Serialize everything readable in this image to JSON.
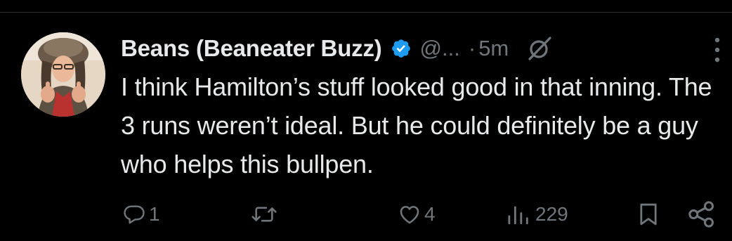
{
  "tweet": {
    "author": {
      "display_name": "Beans (Beaneater Buzz)",
      "handle": "@...",
      "verified": true
    },
    "separator": "·",
    "time": "5m",
    "text": "I think Hamilton’s stuff looked good in that inning. The 3 runs weren’t ideal. But he could definitely be a guy who helps this bullpen.",
    "actions": {
      "replies": "1",
      "reposts": "",
      "likes": "4",
      "views": "229"
    }
  },
  "colors": {
    "background": "#000000",
    "text_primary": "#e7e9ea",
    "text_secondary": "#71767b",
    "verified_badge": "#1d9bf0",
    "divider": "#2f3336"
  },
  "icons": {
    "verified": "verified-badge-icon",
    "grok": "grok-icon",
    "more": "more-options-icon",
    "reply": "reply-icon",
    "repost": "repost-icon",
    "like": "like-icon",
    "views": "views-icon",
    "bookmark": "bookmark-icon",
    "share": "share-icon"
  }
}
